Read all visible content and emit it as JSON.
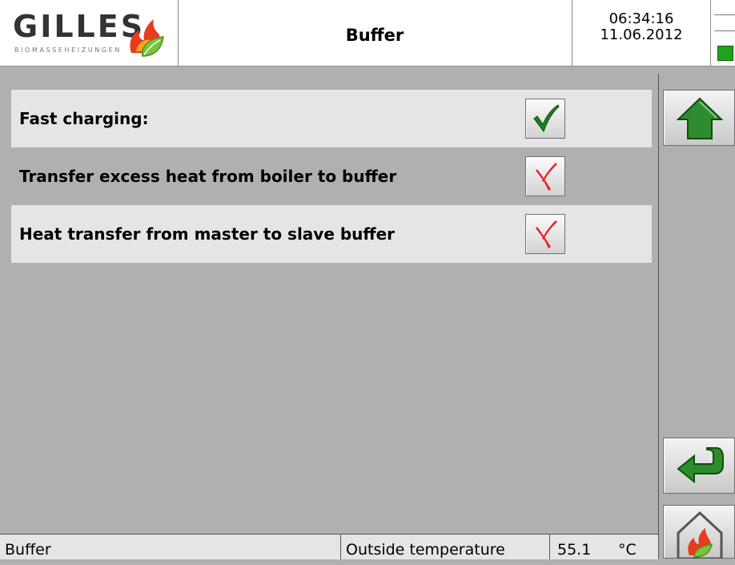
{
  "header": {
    "logo_text": "GILLES",
    "logo_subtext": "BIOMASSEHEIZUNGEN",
    "title": "Buffer",
    "time": "06:34:16",
    "date": "11.06.2012",
    "status_led_color": "#1fa31f"
  },
  "rows": [
    {
      "label": "Fast charging:",
      "checked": true,
      "icon": "checkmark-icon"
    },
    {
      "label": "Transfer excess heat from boiler to buffer",
      "checked": false,
      "icon": "cross-icon"
    },
    {
      "label": "Heat transfer from master to slave buffer",
      "checked": false,
      "icon": "cross-icon"
    }
  ],
  "sidebar": {
    "buttons": [
      {
        "name": "home-button",
        "icon": "house-up-arrow-icon"
      },
      {
        "name": "back-button",
        "icon": "return-arrow-icon"
      },
      {
        "name": "boiler-button",
        "icon": "house-flame-icon"
      }
    ]
  },
  "status_bar": {
    "screen_name": "Buffer",
    "measurement_label": "Outside temperature",
    "measurement_value": "55.1",
    "measurement_unit": "°C"
  },
  "colors": {
    "background": "#aeb1ae",
    "row_highlight": "#e4e5e4",
    "accent_green": "#2e8b2e",
    "cross_red": "#e8232a"
  }
}
